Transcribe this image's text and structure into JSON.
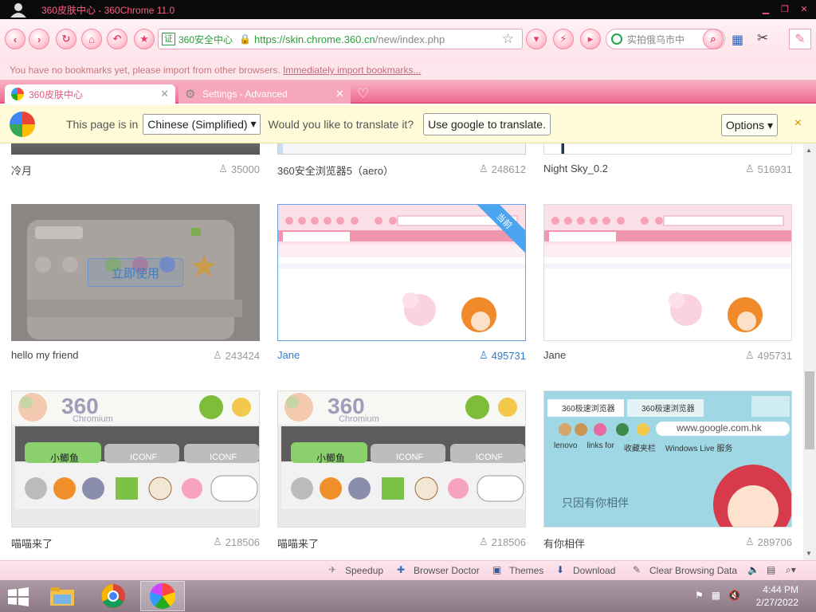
{
  "window": {
    "title": "360皮肤中心 - 360Chrome 11.0",
    "controls": [
      "minimize",
      "restore",
      "close"
    ]
  },
  "toolbar": {
    "cert_label": "证",
    "cert_name": "360安全中心",
    "url_scheme": "https://",
    "url_host": "skin.chrome.360.cn",
    "url_path": "/new/index.php",
    "search_placeholder": "实拍俄乌市中",
    "nav_buttons": [
      "back",
      "forward",
      "refresh",
      "home",
      "undo",
      "favorites"
    ]
  },
  "bookmark_bar": {
    "message": "You have no bookmarks yet, please import from other browsers.",
    "link": "Immediately import bookmarks..."
  },
  "tabs": [
    {
      "label": "360皮肤中心",
      "active": true
    },
    {
      "label": "Settings - Advanced",
      "active": false
    }
  ],
  "translate_bar": {
    "prefix": "This page is in",
    "language": "Chinese (Simplified)",
    "question": "Would you like to translate it?",
    "action": "Use google to translate.",
    "options": "Options",
    "close": "×"
  },
  "skins": {
    "row1": [
      {
        "name": "冷月",
        "count": "35000"
      },
      {
        "name": "360安全浏览器5（aero）",
        "count": "248612"
      },
      {
        "name": "Night Sky_0.2",
        "count": "516931"
      }
    ],
    "row2": [
      {
        "name": "hello my friend",
        "count": "243424",
        "apply_label": "立即使用"
      },
      {
        "name": "Jane",
        "count": "495731",
        "current": true,
        "ribbon": "当前"
      },
      {
        "name": "Jane",
        "count": "495731"
      }
    ],
    "row3": [
      {
        "name": "喵喵来了",
        "count": "218506",
        "tab_label": "小鲫鱼",
        "inactive_tab": "ICONF"
      },
      {
        "name": "喵喵来了",
        "count": "218506",
        "tab_label": "小鲫鱼",
        "inactive_tab": "ICONF"
      },
      {
        "name": "有你相伴",
        "count": "289706",
        "tab1": "360极速浏览器",
        "tab2": "360极速浏览器",
        "url": "www.google.com.hk",
        "bookmarks": [
          "lenovo",
          "links for",
          "收藏夹栏",
          "Windows Live 服务"
        ],
        "caption": "只因有你相伴"
      }
    ]
  },
  "status_bar": {
    "items": [
      "Speedup",
      "Browser Doctor",
      "Themes",
      "Download",
      "Clear Browsing Data"
    ]
  },
  "taskbar": {
    "time": "4:44 PM",
    "date": "2/27/2022"
  },
  "colors": {
    "accent_pink": "#f06c92",
    "link_blue": "#2e7ad2",
    "titlebar_bg": "#0a0a0a"
  }
}
